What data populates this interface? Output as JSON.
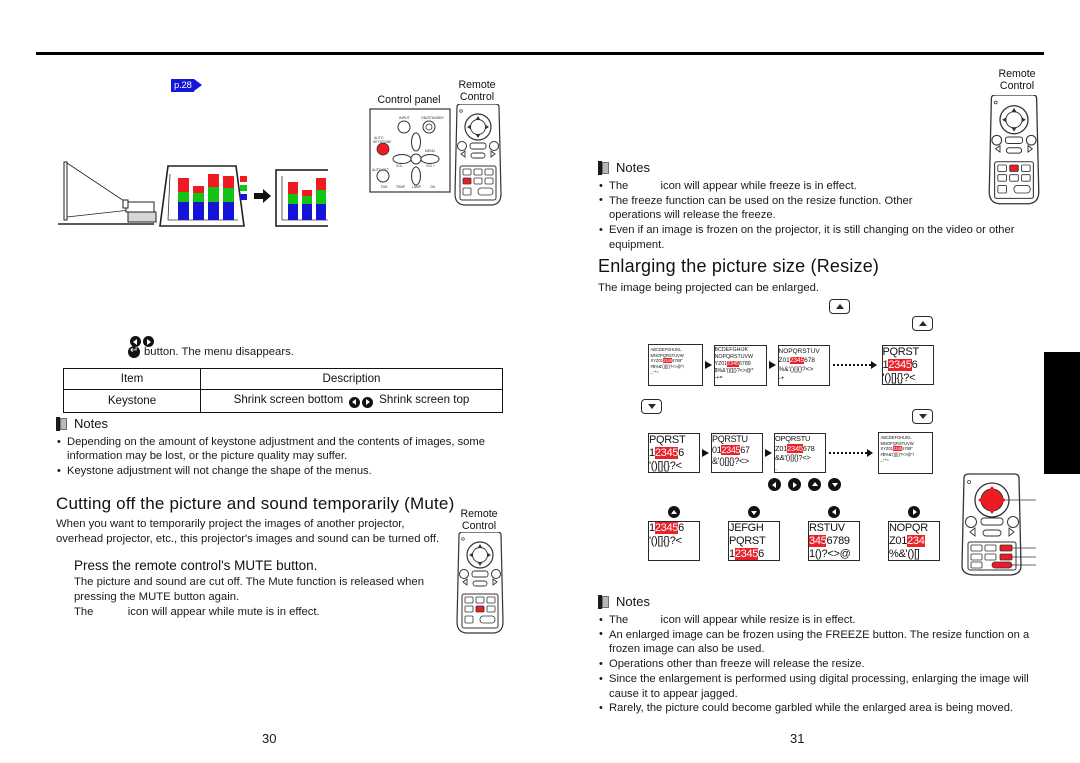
{
  "document": {
    "left_page_number": "30",
    "right_page_number": "31"
  },
  "left_page": {
    "jump_reference": {
      "label": "p.28"
    },
    "keystone_illustration": {
      "caption_projector": "projector-on-stand",
      "before_label": "trapezoid-projected-chart",
      "after_label": "corrected-rectangular-chart"
    },
    "diagrams": {
      "control_panel_caption": "Control panel",
      "remote_control_caption_1": "Remote\nControl",
      "control_panel_labels": [
        "INPUT",
        "ON/STANDBY",
        "AUTO SET",
        "KEYSTONE",
        "MENU",
        "VOL -",
        "VOL +",
        "FAN",
        "TEMP",
        "LAMP",
        "ON"
      ],
      "remote_control_caption_2": "Remote\nControl"
    },
    "menu_step": {
      "text": "button. The menu disappears."
    },
    "keystone_table": {
      "headers": [
        "Item",
        "Description"
      ],
      "rows": [
        {
          "item": "Keystone",
          "description_left": "Shrink screen bottom",
          "description_right": "Shrink screen top"
        }
      ]
    },
    "keystone_notes": {
      "title": "Notes",
      "items": [
        "Depending on the amount of keystone adjustment and the contents of images, some information may be lost, or the picture quality may suffer.",
        "Keystone adjustment will not change the shape of the menus."
      ]
    },
    "mute_section": {
      "heading": "Cutting off the picture and sound temporarily (Mute)",
      "intro": "When you want to temporarily project the images of another projector, overhead projector, etc., this projector's images and sound can be turned off.",
      "step_heading": "Press the remote control's MUTE button.",
      "step_body_1": "The picture and sound are cut off. The Mute function is released when pressing the MUTE button again.",
      "step_body_2_pre": "The",
      "step_body_2_post": "icon will appear while mute is in effect."
    }
  },
  "right_page": {
    "freeze_notes": {
      "title": "Notes",
      "items": [
        {
          "pre": "The",
          "post": "icon will appear while freeze is in effect.",
          "has_icon_gap": true
        },
        {
          "text": "The freeze function can be used on the resize function. Other operations will release the freeze."
        },
        {
          "text": "Even if an image is frozen on the projector, it is still changing on the video or other equipment."
        }
      ]
    },
    "resize_section": {
      "heading": "Enlarging the picture size (Resize)",
      "intro": "The image being projected can be enlarged."
    },
    "resize_notes": {
      "title": "Notes",
      "items": [
        {
          "pre": "The",
          "post": "icon will appear while resize is in effect.",
          "has_icon_gap": true
        },
        {
          "text": "An enlarged image can be frozen using the FREEZE button. The resize function on a frozen image can also be used."
        },
        {
          "text": "Operations other than freeze will release the resize."
        },
        {
          "text": "Since the enlargement is performed using digital processing, enlarging the image will cause it to appear jagged."
        },
        {
          "text": "Rarely, the picture could become garbled while the enlarged area is being moved."
        }
      ]
    },
    "remote_control_caption": "Remote\nControl"
  },
  "resize_diagram": {
    "zoom_in_row": {
      "label": "zoom-in-sequence",
      "frames": [
        {
          "lines": [
            "ABCDEFGHIJKL",
            "MNOPQRSTUVW",
            "XYZ01",
            "2345",
            "6789\"",
            "#$%&'()[]{}?<>@*"
          ],
          "scale": 1
        },
        {
          "lines": [
            "BCDEFGHIJK",
            "NOPQRSTUVW",
            "YZ01",
            "2345",
            "6789"
          ],
          "scale": 2
        },
        {
          "lines": [
            "NOPQRSTUV",
            "Z01",
            "2345",
            "678"
          ],
          "scale": 3
        },
        {
          "lines": [
            "PQRST",
            "1",
            "23456",
            "'()[]{}?<"
          ],
          "scale": 4
        }
      ],
      "button": "zoom-in-up"
    },
    "zoom_out_row": {
      "label": "zoom-out-sequence",
      "frames": [
        {
          "lines": [
            "PQRST",
            "1",
            "23456"
          ],
          "scale": 4
        },
        {
          "lines": [
            "PQRSTU",
            "01",
            "2345",
            "67"
          ],
          "scale": 3
        },
        {
          "lines": [
            "OPQRSTU",
            "Z01",
            "2345",
            "678"
          ],
          "scale": 2
        },
        {
          "lines": [
            "ABCDEFGHIJKL",
            "MNOPQRSTUVW",
            "XYZ01",
            "2345",
            "6789\""
          ],
          "scale": 1
        }
      ],
      "button": "zoom-out-down"
    },
    "pan_buttons": [
      "left",
      "right",
      "up",
      "down"
    ],
    "pan_results": [
      {
        "direction": "up",
        "lines": [
          "1",
          "23456",
          "'()[]{}?<"
        ]
      },
      {
        "direction": "down",
        "lines": [
          "JEFGH",
          "PQRST",
          "1",
          "23456"
        ]
      },
      {
        "direction": "left",
        "lines": [
          "RSTUV",
          "345",
          "6789",
          "1()?<>@"
        ]
      },
      {
        "direction": "right",
        "lines": [
          "NOPQR",
          "Z01",
          "234",
          "%&'()[]"
        ]
      }
    ]
  },
  "colors": {
    "highlight_red": "#e8232a",
    "jump_blue": "#1616d8",
    "remote_key_red": "#e8232a",
    "rule_black": "#000000"
  }
}
